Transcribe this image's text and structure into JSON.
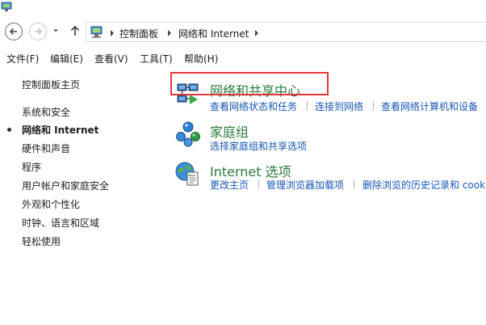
{
  "address_bar": {
    "crumbs": [
      "控制面板",
      "网络和 Internet"
    ]
  },
  "menu": [
    "文件(F)",
    "编辑(E)",
    "查看(V)",
    "工具(T)",
    "帮助(H)"
  ],
  "sidebar": {
    "home": "控制面板主页",
    "items": [
      {
        "label": "系统和安全",
        "active": false
      },
      {
        "label": "网络和 Internet",
        "active": true
      },
      {
        "label": "硬件和声音",
        "active": false
      },
      {
        "label": "程序",
        "active": false
      },
      {
        "label": "用户帐户和家庭安全",
        "active": false
      },
      {
        "label": "外观和个性化",
        "active": false
      },
      {
        "label": "时钟、语言和区域",
        "active": false
      },
      {
        "label": "轻松使用",
        "active": false
      }
    ]
  },
  "categories": [
    {
      "title": "网络和共享中心",
      "icon": "network-sharing-center-icon",
      "links": [
        "查看网络状态和任务",
        "连接到网络",
        "查看网络计算机和设备"
      ]
    },
    {
      "title": "家庭组",
      "icon": "homegroup-icon",
      "links": [
        "选择家庭组和共享选项"
      ]
    },
    {
      "title": "Internet 选项",
      "icon": "internet-options-icon",
      "links": [
        "更改主页",
        "管理浏览器加载项",
        "删除浏览的历史记录和 cook"
      ]
    }
  ],
  "colors": {
    "category_title": "#2c7a3e",
    "link": "#1756b5",
    "highlight": "#e2373c"
  }
}
